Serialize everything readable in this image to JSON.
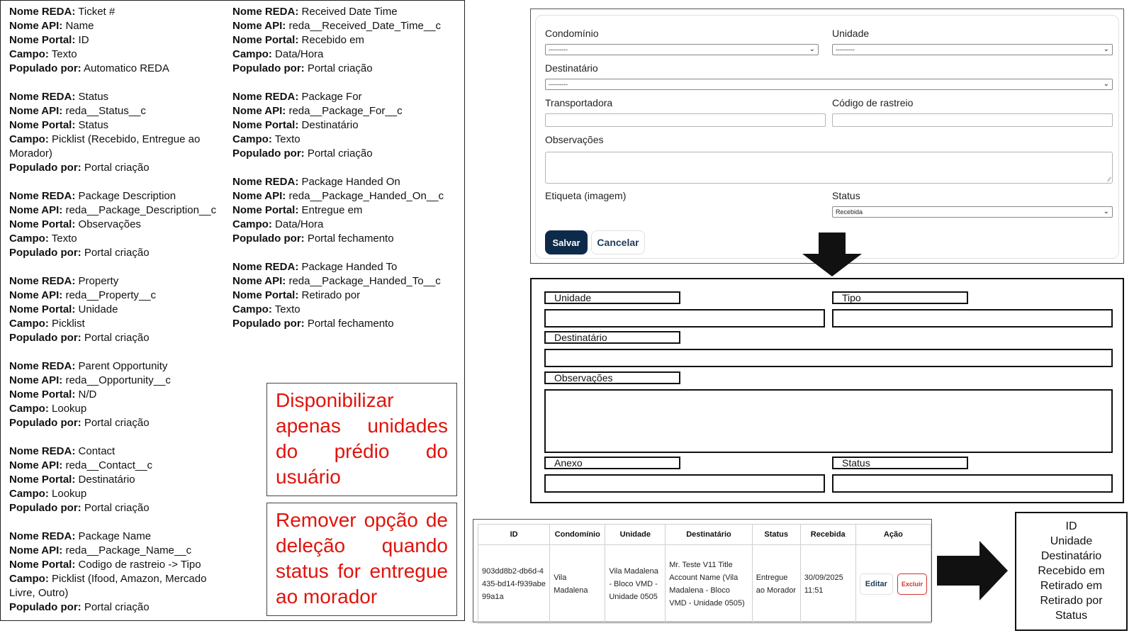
{
  "spec": {
    "left_column": [
      {
        "nome_reda": "Ticket #",
        "nome_api": "Name",
        "nome_portal": "ID",
        "campo": "Texto",
        "populado_por": "Automatico REDA"
      },
      {
        "nome_reda": "Status",
        "nome_api": "reda__Status__c",
        "nome_portal": "Status",
        "campo": "Picklist (Recebido, Entregue ao Morador)",
        "populado_por": "Portal criação"
      },
      {
        "nome_reda": "Package Description",
        "nome_api": "reda__Package_Description__c",
        "nome_portal": "Observações",
        "campo": "Texto",
        "populado_por": "Portal criação"
      },
      {
        "nome_reda": "Property",
        "nome_api": "reda__Property__c",
        "nome_portal": "Unidade",
        "campo": "Picklist",
        "populado_por": "Portal criação"
      },
      {
        "nome_reda": "Parent Opportunity",
        "nome_api": "reda__Opportunity__c",
        "nome_portal": "N/D",
        "campo": "Lookup",
        "populado_por": "Portal criação"
      },
      {
        "nome_reda": "Contact",
        "nome_api": "reda__Contact__c",
        "nome_portal": "Destinatário",
        "campo": "Lookup",
        "populado_por": "Portal criação"
      },
      {
        "nome_reda": "Package Name",
        "nome_api": "reda__Package_Name__c",
        "nome_portal": "Codigo de rastreio -> Tipo",
        "campo": "Picklist (Ifood, Amazon, Mercado Livre, Outro)",
        "populado_por": "Portal criação"
      }
    ],
    "right_column": [
      {
        "nome_reda": "Received Date Time",
        "nome_api": "reda__Received_Date_Time__c",
        "nome_portal": "Recebido em",
        "campo": "Data/Hora",
        "populado_por": "Portal criação"
      },
      {
        "nome_reda": "Package For",
        "nome_api": "reda__Package_For__c",
        "nome_portal": "Destinatário",
        "campo": "Texto",
        "populado_por": "Portal criação"
      },
      {
        "nome_reda": "Package Handed On",
        "nome_api": "reda__Package_Handed_On__c",
        "nome_portal": "Entregue em",
        "campo": "Data/Hora",
        "populado_por": "Portal fechamento"
      },
      {
        "nome_reda": "Package Handed To",
        "nome_api": "reda__Package_Handed_To__c",
        "nome_portal": "Retirado por",
        "campo": "Texto",
        "populado_por": "Portal fechamento"
      }
    ],
    "keys": {
      "nome_reda": "Nome REDA:",
      "nome_api": "Nome API:",
      "nome_portal": "Nome Portal:",
      "campo": "Campo:",
      "populado_por": "Populado por:"
    }
  },
  "notes": {
    "note1": "Disponibilizar apenas unidades do prédio do usuário",
    "note2": "Remover opção de deleção quando status for entregue ao morador"
  },
  "form": {
    "condominio_label": "Condomínio",
    "condominio_value": "---------",
    "unidade_label": "Unidade",
    "unidade_value": "---------",
    "destinatario_label": "Destinatário",
    "destinatario_value": "---------",
    "transportadora_label": "Transportadora",
    "codigo_label": "Código de rastreio",
    "observacoes_label": "Observações",
    "etiqueta_label": "Etiqueta (imagem)",
    "status_label": "Status",
    "status_value": "Recebida",
    "save_label": "Salvar",
    "cancel_label": "Cancelar"
  },
  "mockup": {
    "unidade": "Unidade",
    "tipo": "Tipo",
    "destinatario": "Destinatário",
    "observacoes": "Observações",
    "anexo": "Anexo",
    "status": "Status"
  },
  "table": {
    "headers": [
      "ID",
      "Condomínio",
      "Unidade",
      "Destinatário",
      "Status",
      "Recebida",
      "Ação"
    ],
    "row": {
      "id": "903dd8b2-db6d-4435-bd14-f939abe99a1a",
      "condominio": "Vila Madalena",
      "unidade": "Vila Madalena - Bloco VMD - Unidade 0505",
      "destinatario": "Mr. Teste V11 Title Account Name (Vila Madalena - Bloco VMD - Unidade 0505)",
      "status": "Entregue ao Morador",
      "recebida": "30/09/2025 11:51",
      "edit_label": "Editar",
      "delete_label": "Excluir"
    }
  },
  "columns_list": [
    "ID",
    "Unidade",
    "Destinatário",
    "Recebido em",
    "Retirado em",
    "Retirado por",
    "Status"
  ]
}
